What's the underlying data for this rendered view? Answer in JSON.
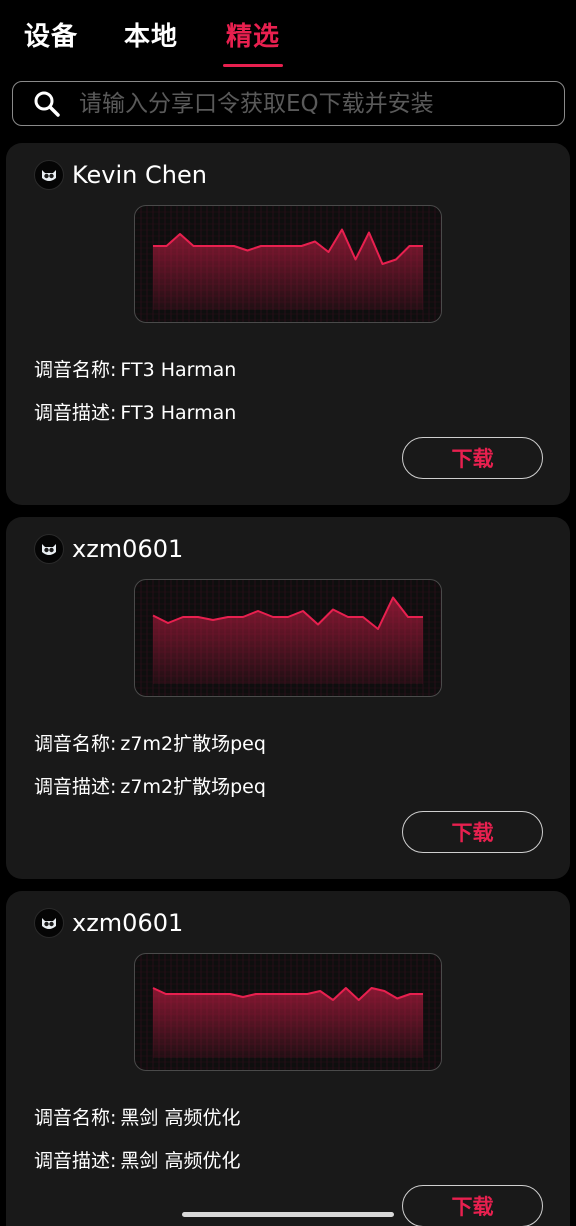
{
  "tabs": [
    {
      "label": "设备",
      "active": false
    },
    {
      "label": "本地",
      "active": false
    },
    {
      "label": "精选",
      "active": true
    }
  ],
  "search": {
    "placeholder": "请输入分享口令获取EQ下载并安装",
    "value": "",
    "icon": "search-icon"
  },
  "colors": {
    "accent": "#e8204f",
    "background": "#000000",
    "card": "#191919"
  },
  "cards": [
    {
      "username": "Kevin Chen",
      "name_label": "调音名称:",
      "name_value": "FT3 Harman",
      "desc_label": "调音描述:",
      "desc_value": "FT3 Harman",
      "download_label": "下载",
      "eq_curve": [
        0,
        0,
        0.4,
        0,
        0,
        0,
        0,
        -0.15,
        0,
        0,
        0,
        0,
        0.15,
        -0.2,
        0.55,
        -0.45,
        0.45,
        -0.6,
        -0.45,
        0,
        0
      ]
    },
    {
      "username": "xzm0601",
      "name_label": "调音名称:",
      "name_value": "z7m2扩散场peq",
      "desc_label": "调音描述:",
      "desc_value": "z7m2扩散场peq",
      "download_label": "下载",
      "eq_curve": [
        0.15,
        -0.1,
        0.1,
        0.1,
        0,
        0.1,
        0.1,
        0.3,
        0.1,
        0.1,
        0.3,
        -0.15,
        0.35,
        0.1,
        0.1,
        -0.3,
        0.75,
        0.1,
        0.1
      ]
    },
    {
      "username": "xzm0601",
      "name_label": "调音名称:",
      "name_value": "黑剑 高频优化",
      "desc_label": "调音描述:",
      "desc_value": "黑剑 高频优化",
      "download_label": "下载",
      "eq_curve": [
        0.2,
        0,
        0,
        0,
        0,
        0,
        0,
        -0.1,
        0,
        0,
        0,
        0,
        0,
        0.1,
        -0.2,
        0.2,
        -0.2,
        0.2,
        0.1,
        -0.15,
        0,
        0
      ]
    }
  ]
}
